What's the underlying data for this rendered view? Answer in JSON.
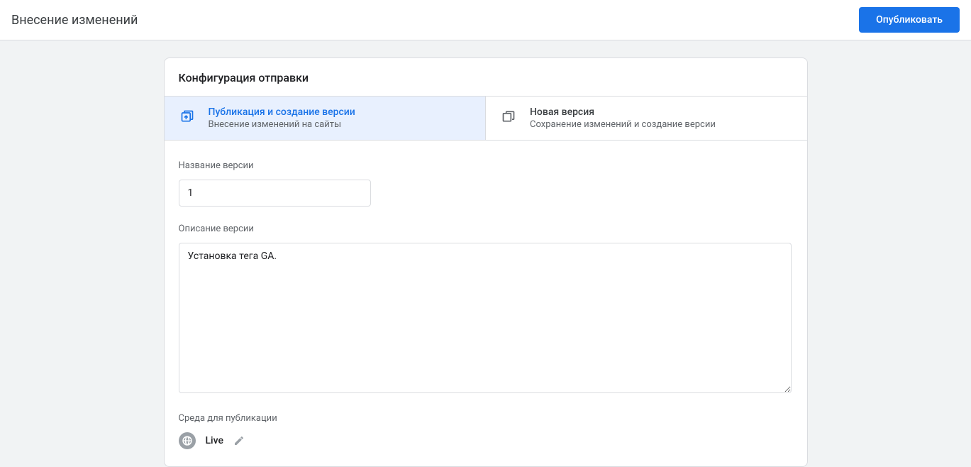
{
  "header": {
    "title": "Внесение изменений",
    "publish_button": "Опубликовать"
  },
  "card": {
    "title": "Конфигурация отправки"
  },
  "tabs": {
    "publish": {
      "title": "Публикация и создание версии",
      "subtitle": "Внесение изменений на сайты"
    },
    "new_version": {
      "title": "Новая версия",
      "subtitle": "Сохранение изменений и создание версии"
    }
  },
  "form": {
    "version_name_label": "Название версии",
    "version_name_value": "1",
    "version_desc_label": "Описание версии",
    "version_desc_value": "Установка тега GA.",
    "environment_label": "Среда для публикации",
    "environment_name": "Live"
  }
}
